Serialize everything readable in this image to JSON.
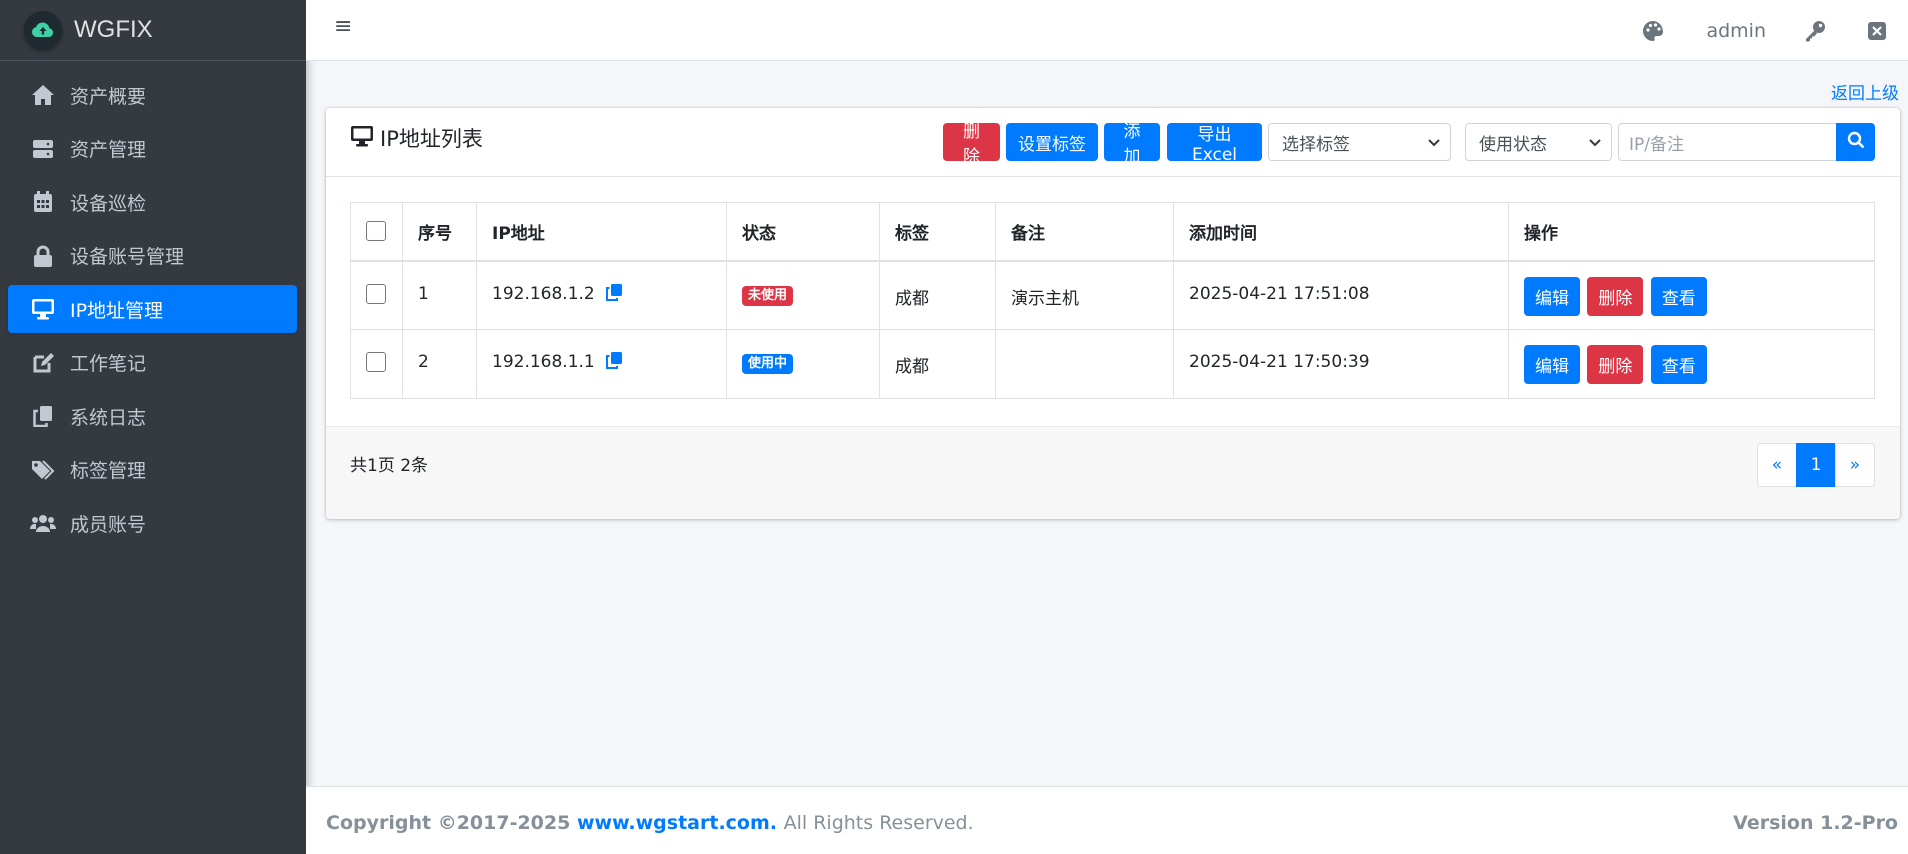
{
  "brand": {
    "name": "WGFIX",
    "logo_icon": "cloud-upload-icon"
  },
  "sidebar": {
    "items": [
      {
        "label": "资产概要",
        "icon": "home-icon",
        "active": false
      },
      {
        "label": "资产管理",
        "icon": "server-icon",
        "active": false
      },
      {
        "label": "设备巡检",
        "icon": "calendar-icon",
        "active": false
      },
      {
        "label": "设备账号管理",
        "icon": "lock-icon",
        "active": false
      },
      {
        "label": "IP地址管理",
        "icon": "desktop-icon",
        "active": true
      },
      {
        "label": "工作笔记",
        "icon": "edit-icon",
        "active": false
      },
      {
        "label": "系统日志",
        "icon": "copy-icon",
        "active": false
      },
      {
        "label": "标签管理",
        "icon": "tags-icon",
        "active": false
      },
      {
        "label": "成员账号",
        "icon": "users-icon",
        "active": false
      }
    ]
  },
  "header": {
    "menu_icon": "≡",
    "user": "admin",
    "icons": [
      "palette-icon",
      "key-icon",
      "close-square-icon"
    ]
  },
  "back_link": "返回上级",
  "card": {
    "title": "IP地址列表",
    "buttons": {
      "delete": "删除",
      "set_tag": "设置标签",
      "add": "添加",
      "export": "导出Excel"
    },
    "tag_select": "选择标签",
    "status_select": "使用状态",
    "search_placeholder": "IP/备注"
  },
  "table": {
    "headers": [
      "序号",
      "IP地址",
      "状态",
      "标签",
      "备注",
      "添加时间",
      "操作"
    ],
    "rows": [
      {
        "no": "1",
        "ip": "192.168.1.2",
        "status": "未使用",
        "status_color": "#dc3545",
        "tag": "成都",
        "remark": "演示主机",
        "time": "2025-04-21 17:51:08"
      },
      {
        "no": "2",
        "ip": "192.168.1.1",
        "status": "使用中",
        "status_color": "#007bff",
        "tag": "成都",
        "remark": "",
        "time": "2025-04-21 17:50:39"
      }
    ],
    "actions": {
      "edit": "编辑",
      "delete": "删除",
      "view": "查看"
    }
  },
  "pagination": {
    "info": "共1页 2条",
    "prev": "«",
    "current": "1",
    "next": "»"
  },
  "footer": {
    "copyright": "Copyright ©2017-2025",
    "site": "www.wgstart.com.",
    "rights": "All Rights Reserved.",
    "version": "Version 1.2-Pro"
  },
  "colors": {
    "primary": "#007bff",
    "danger": "#dc3545",
    "sidebar": "#343a40"
  }
}
